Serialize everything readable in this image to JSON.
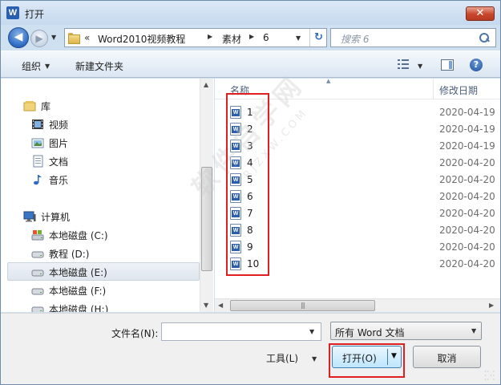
{
  "window": {
    "app_icon_letter": "W",
    "title": "打开",
    "close_glyph": "✕"
  },
  "nav": {
    "back_glyph": "◀",
    "forward_glyph": "▶",
    "history_caret": "▼",
    "address_chevron": "«",
    "breadcrumbs": [
      "Word2010视频教程",
      "素材",
      "6"
    ],
    "crumb_sep": "▶",
    "address_caret": "▼",
    "refresh_glyph": "↻",
    "search_placeholder": "搜索 6"
  },
  "toolbar": {
    "organize_label": "组织",
    "organize_caret": "▼",
    "new_folder_label": "新建文件夹",
    "views_caret": "▼",
    "help_glyph": "?"
  },
  "navpane": {
    "items": [
      {
        "label": "库",
        "icon": "library-icon"
      },
      {
        "label": "视频",
        "icon": "video-icon"
      },
      {
        "label": "图片",
        "icon": "pictures-icon"
      },
      {
        "label": "文档",
        "icon": "documents-icon"
      },
      {
        "label": "音乐",
        "icon": "music-icon"
      },
      {
        "label": "计算机",
        "icon": "computer-icon"
      },
      {
        "label": "本地磁盘 (C:)",
        "icon": "system-drive-icon"
      },
      {
        "label": "教程 (D:)",
        "icon": "drive-icon"
      },
      {
        "label": "本地磁盘 (E:)",
        "icon": "drive-icon",
        "selected": true
      },
      {
        "label": "本地磁盘 (F:)",
        "icon": "drive-icon"
      },
      {
        "label": "本地磁盘 (H:)",
        "icon": "drive-icon"
      }
    ],
    "scroll_up": "▲",
    "scroll_down": "▼"
  },
  "filelist": {
    "col_name": "名称",
    "col_date": "修改日期",
    "sort_glyph": "▲",
    "files": [
      {
        "name": "1",
        "date": "2020-04-19"
      },
      {
        "name": "2",
        "date": "2020-04-19"
      },
      {
        "name": "3",
        "date": "2020-04-19"
      },
      {
        "name": "4",
        "date": "2020-04-20"
      },
      {
        "name": "5",
        "date": "2020-04-20"
      },
      {
        "name": "6",
        "date": "2020-04-20"
      },
      {
        "name": "7",
        "date": "2020-04-20"
      },
      {
        "name": "8",
        "date": "2020-04-20"
      },
      {
        "name": "9",
        "date": "2020-04-20"
      },
      {
        "name": "10",
        "date": "2020-04-20"
      }
    ],
    "hscroll_left": "◀",
    "hscroll_right": "▶",
    "hthumb_grip": "|||"
  },
  "bottom": {
    "filename_label": "文件名(N):",
    "filename_value": "",
    "filename_caret": "▼",
    "filetype_value": "所有 Word 文档",
    "filetype_caret": "▼",
    "tools_label": "工具(L)",
    "tools_caret": "▼",
    "open_label": "打开(O)",
    "open_caret": "▼",
    "cancel_label": "取消"
  },
  "watermark": {
    "text": "软件自学网",
    "sub": "RJZXW.COM"
  },
  "colors": {
    "annotation_red": "#e02020",
    "title_bar": "#c6d9ee",
    "open_button": "#bee6fd"
  }
}
